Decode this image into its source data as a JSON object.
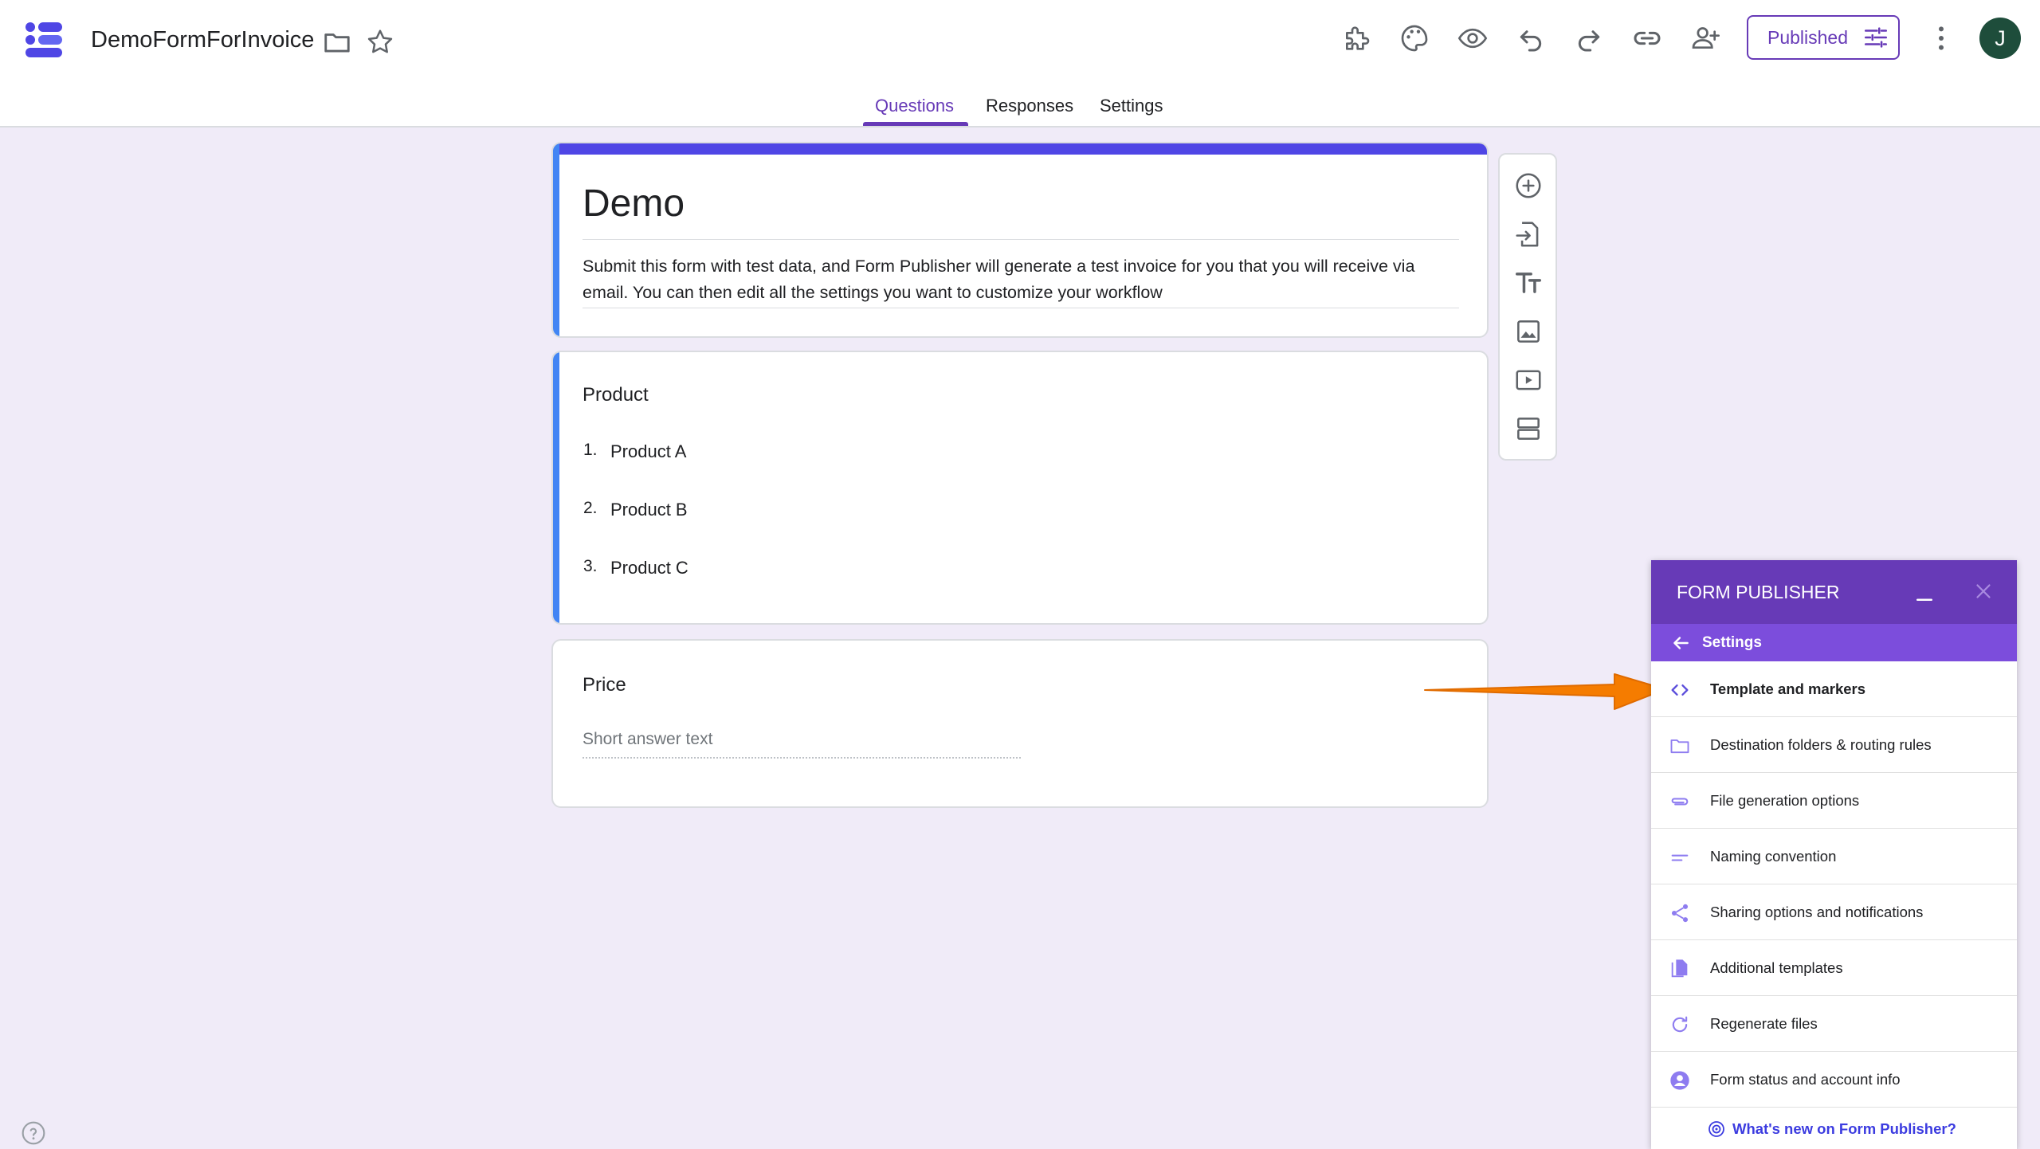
{
  "header": {
    "doc_title": "DemoFormForInvoice",
    "published_label": "Published",
    "avatar_initial": "J"
  },
  "tabs": [
    {
      "label": "Questions",
      "active": true
    },
    {
      "label": "Responses",
      "active": false
    },
    {
      "label": "Settings",
      "active": false
    }
  ],
  "form": {
    "title": "Demo",
    "description": "Submit this form with test data, and Form Publisher will generate a test invoice for you that you will receive via email. You can then edit all the settings you want to customize your workflow",
    "questions": [
      {
        "title": "Product",
        "options": [
          {
            "num": "1.",
            "label": "Product A"
          },
          {
            "num": "2.",
            "label": "Product B"
          },
          {
            "num": "3.",
            "label": "Product C"
          }
        ]
      },
      {
        "title": "Price",
        "placeholder": "Short answer text"
      }
    ]
  },
  "side_toolbar": [
    "add-question-icon",
    "import-questions-icon",
    "add-title-icon",
    "add-image-icon",
    "add-video-icon",
    "add-section-icon"
  ],
  "form_publisher": {
    "title": "FORM PUBLISHER",
    "section": "Settings",
    "items": [
      {
        "label": "Template and markers",
        "icon": "code-icon",
        "selected": true
      },
      {
        "label": "Destination folders & routing rules",
        "icon": "folder-icon",
        "selected": false
      },
      {
        "label": "File generation options",
        "icon": "attachment-icon",
        "selected": false
      },
      {
        "label": "Naming convention",
        "icon": "short-text-icon",
        "selected": false
      },
      {
        "label": "Sharing options and notifications",
        "icon": "share-icon",
        "selected": false
      },
      {
        "label": "Additional templates",
        "icon": "file-copy-icon",
        "selected": false
      },
      {
        "label": "Regenerate files",
        "icon": "refresh-icon",
        "selected": false
      },
      {
        "label": "Form status and account info",
        "icon": "account-circle-icon",
        "selected": false
      }
    ],
    "footer_link": "What's new on Form Publisher?"
  },
  "colors": {
    "accent": "#673ab7",
    "form_top_bar": "#4f46e5",
    "question_bar": "#4285f4",
    "background": "#f0ebf8",
    "arrow": "#f57c00"
  }
}
